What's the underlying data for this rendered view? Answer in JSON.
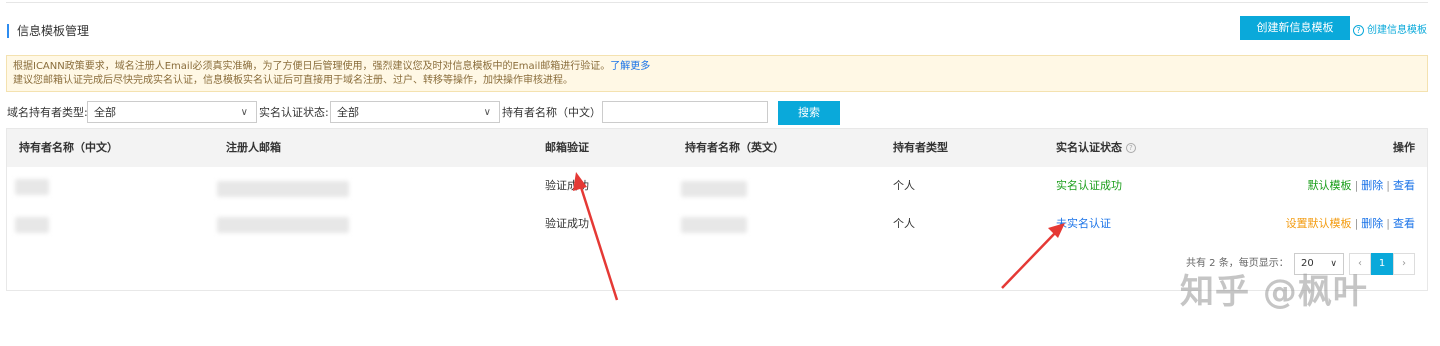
{
  "page_title": "信息模板管理",
  "create_button": "创建新信息模板",
  "help_link": "创建信息模板",
  "notice": {
    "line1": "根据ICANN政策要求，域名注册人Email必须真实准确，为了方便日后管理使用，强烈建议您及时对信息模板中的Email邮箱进行验证。",
    "learn_more": "了解更多",
    "line2": "建议您邮箱认证完成后尽快完成实名认证，信息模板实名认证后可直接用于域名注册、过户、转移等操作，加快操作审核进程。"
  },
  "filters": {
    "domain_holder_type_label": "域名持有者类型:",
    "domain_holder_type_value": "全部",
    "real_name_status_label": "实名认证状态:",
    "real_name_status_value": "全部",
    "holder_name_label": "持有者名称（中文）:",
    "holder_name_value": "",
    "search_button": "搜索"
  },
  "table": {
    "columns": [
      "持有者名称（中文）",
      "注册人邮箱",
      "邮箱验证",
      "持有者名称（英文）",
      "持有者类型",
      "实名认证状态",
      "操作"
    ],
    "rows": [
      {
        "email_verify": "验证成功",
        "holder_type": "个人",
        "real_name_status": "实名认证成功",
        "actions": [
          "默认模板",
          "删除",
          "查看"
        ]
      },
      {
        "email_verify": "验证成功",
        "holder_type": "个人",
        "real_name_status": "未实名认证",
        "actions": [
          "设置默认模板",
          "删除",
          "查看"
        ]
      }
    ]
  },
  "pagination": {
    "summary": "共有 2 条，每页显示：",
    "page_size": "20",
    "prev": "‹",
    "current_page": "1",
    "next": "›"
  },
  "watermark": "知乎 @枫叶",
  "colors": {
    "accent": "#0aa9da",
    "success": "#1b9e1b",
    "link": "#1a73e8",
    "warning": "#f39c12",
    "annotation_arrow": "#e53935"
  },
  "icons": {
    "dropdown": "chevron-down-icon",
    "help": "question-circle-icon"
  }
}
